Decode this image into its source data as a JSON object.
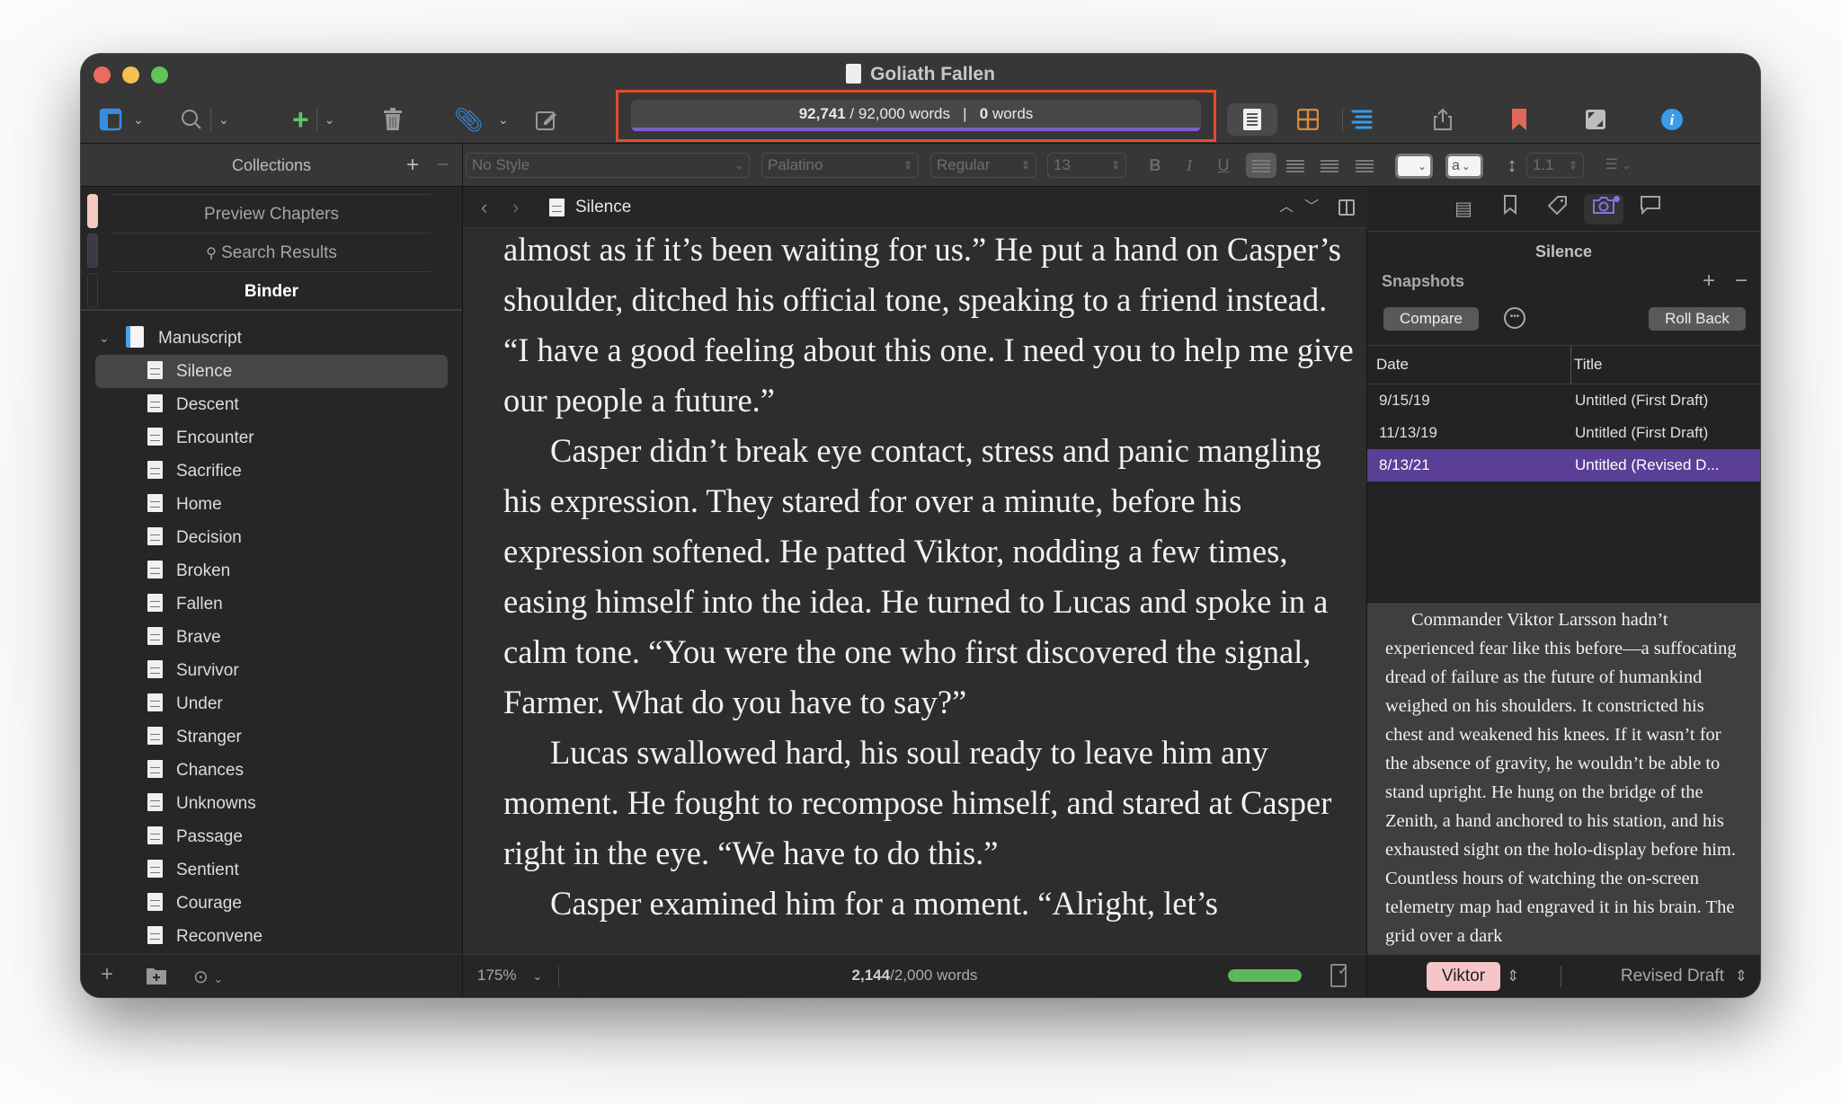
{
  "window": {
    "title": "Goliath Fallen"
  },
  "toolbar": {
    "icons": [
      "sidebar-icon",
      "search-icon",
      "add-icon",
      "trash-icon",
      "attachment-icon",
      "compose-icon",
      "document-view-icon",
      "corkboard-icon",
      "outline-icon",
      "share-icon",
      "bookmark-icon",
      "composition-mode-icon",
      "inspector-info-icon"
    ],
    "goal": {
      "project_words": "92,741",
      "project_target": "92,000 words",
      "session_words": "0",
      "session_suffix": "words",
      "separator": "|",
      "progress_fraction": 1.0,
      "progress_color": "#7b5ecb",
      "highlight_color": "#e54b2a"
    }
  },
  "format_bar": {
    "style": "No Style",
    "font": "Palatino",
    "weight": "Regular",
    "size": "13",
    "bold": "B",
    "italic": "I",
    "underline": "U",
    "highlight_letter": "a",
    "line_spacing": "1.1"
  },
  "collections": {
    "title": "Collections",
    "add": "+",
    "remove": "−",
    "tabs": [
      {
        "label": "Preview Chapters",
        "color": "#f6c9c0"
      },
      {
        "label": "Search Results",
        "color": "#3b3a46"
      },
      {
        "label": "Binder",
        "color": "#262626"
      }
    ]
  },
  "binder": {
    "root": "Manuscript",
    "items": [
      "Silence",
      "Descent",
      "Encounter",
      "Sacrifice",
      "Home",
      "Decision",
      "Broken",
      "Fallen",
      "Brave",
      "Survivor",
      "Under",
      "Stranger",
      "Chances",
      "Unknowns",
      "Passage",
      "Sentient",
      "Courage",
      "Reconvene"
    ],
    "selected": "Silence"
  },
  "editor": {
    "header_title": "Silence",
    "paragraphs": [
      {
        "indent": false,
        "text": "almost as if it’s been waiting for us.” He put a hand on Casper’s shoulder, ditched his official tone, speaking to a friend instead. “I have a good feeling about this one. I need you to help me give our people a future.”"
      },
      {
        "indent": true,
        "text": "Casper didn’t break eye contact, stress and panic mangling his expression. They stared for over a minute, before his expression softened. He patted Viktor, nodding a few times, easing himself into the idea. He turned to Lucas and spoke in a calm tone. “You were the one who first discovered the signal, Farmer. What do you have to say?”"
      },
      {
        "indent": true,
        "text": "Lucas swallowed hard, his soul ready to leave him any moment. He fought to recompose himself, and stared at Casper right in the eye. “We have to do this.”"
      },
      {
        "indent": true,
        "text": "Casper examined him for a moment. “Alright, let’s"
      }
    ],
    "footer": {
      "zoom": "175%",
      "words": "2,144",
      "target": "/2,000 words",
      "progress_fraction": 1.0,
      "progress_color": "#5cb85c"
    }
  },
  "inspector": {
    "doc_title": "Silence",
    "snapshots_label": "Snapshots",
    "compare": "Compare",
    "roll_back": "Roll Back",
    "columns": [
      "Date",
      "Title"
    ],
    "snapshots": [
      {
        "date": "9/15/19",
        "title": "Untitled (First Draft)"
      },
      {
        "date": "11/13/19",
        "title": "Untitled (First Draft)"
      },
      {
        "date": "8/13/21",
        "title": "Untitled (Revised D..."
      }
    ],
    "selected_index": 2,
    "preview_text": "Commander Viktor Larsson hadn’t experienced fear like this before—a suffocating dread of failure as the future of humankind weighed on his shoulders. It constricted his chest and weakened his knees. If it wasn’t for the absence of gravity, he wouldn’t be able to stand upright. He hung on the bridge of the Zenith, a hand anchored to his station, and his exhausted sight on the holo-display before him. Countless hours of watching the on-screen telemetry map had engraved it in his brain. The grid over a dark",
    "label": "Viktor",
    "label_color": "#f7c5c9",
    "status": "Revised Draft"
  }
}
